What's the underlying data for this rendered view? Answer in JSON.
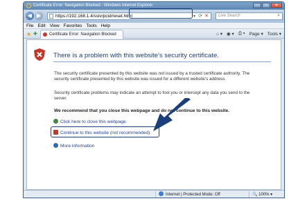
{
  "window": {
    "title": "Certificate Error: Navigation Blocked - Windows Internet Explorer",
    "controls": [
      "–",
      "□",
      "✕"
    ]
  },
  "address_bar": {
    "url": "https://192.168.1.4/sslv/pcid/reset.html",
    "search_placeholder": "Live Search"
  },
  "menu": [
    "File",
    "Edit",
    "View",
    "Favorites",
    "Tools",
    "Help"
  ],
  "tab": {
    "label": "Certificate Error: Navigation Blocked"
  },
  "command_bar": {
    "page_label": "Page",
    "tools_label": "Tools"
  },
  "content": {
    "heading": "There is a problem with this website's security certificate.",
    "para1": "The security certificate presented by this website was not issued by a trusted certificate authority. The security certificate presented by this website was issued for a different website's address.",
    "para2": "Security certificate problems may indicate an attempt to fool you or intercept any data you send to the server.",
    "recommend": "We recommend that you close this webpage and do not continue to this website.",
    "options": {
      "close": "Click here to close this webpage.",
      "continue": "Continue to this website (not recommended).",
      "more_info": "More information"
    }
  },
  "status": {
    "zone": "Internet | Protected Mode: Off",
    "zoom": "100%"
  },
  "colors": {
    "callout": "#1a3f7a",
    "link": "#1f3f9a",
    "heading": "#1f3f7a"
  }
}
